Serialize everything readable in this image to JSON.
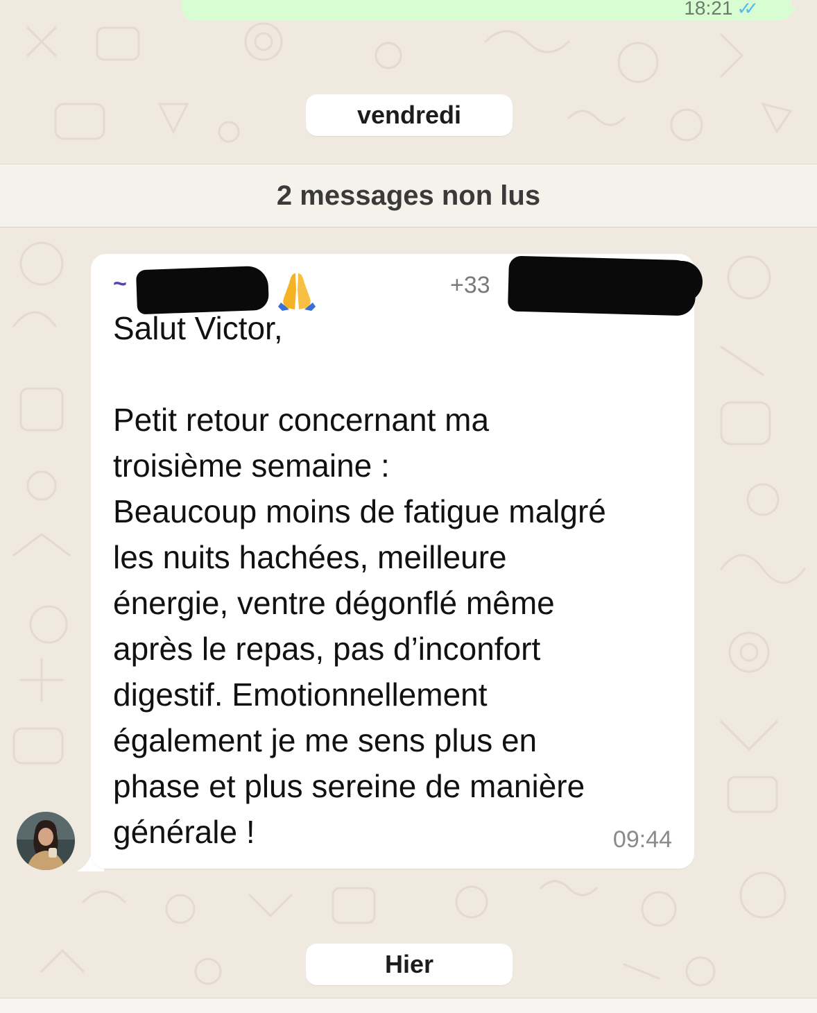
{
  "chat": {
    "previous_message_time": "18:21",
    "date_separator_1": "vendredi",
    "unread_banner": "2 messages non lus",
    "message": {
      "sender_prefix": "~",
      "sender_emoji": "folded-hands-emoji",
      "sender_phone_prefix": "+33",
      "text": "Salut Victor,\n\nPetit retour concernant ma\ntroisième semaine :\nBeaucoup moins de fatigue malgré\nles nuits hachées, meilleure\nénergie, ventre dégonflé même\naprès le repas, pas d’inconfort\ndigestif. Emotionnellement\négalement je me sens plus en\nphase et plus sereine de manière\ngénérale !",
      "time": "09:44"
    },
    "date_separator_2": "Hier"
  },
  "colors": {
    "outgoing_bubble": "#d9fdd3",
    "incoming_bubble": "#ffffff",
    "wallpaper": "#efe9e0",
    "read_ticks": "#53bdeb",
    "sender_name": "#5b3fb5"
  }
}
